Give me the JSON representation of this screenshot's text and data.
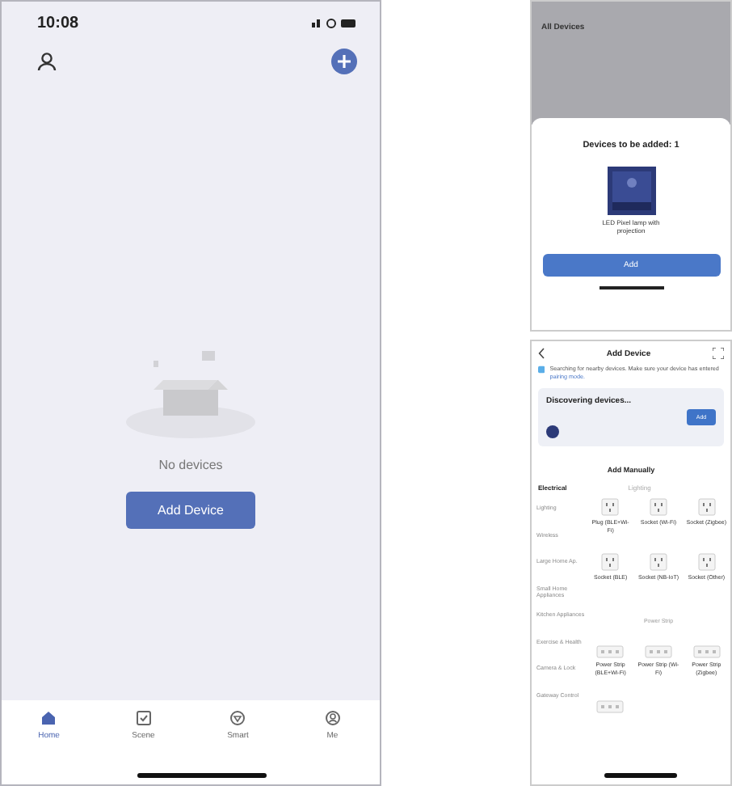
{
  "home": {
    "status_time": "10:08",
    "empty_text": "No devices",
    "add_button": "Add Device",
    "tabs": [
      {
        "label": "Home",
        "kind": "home",
        "selected": true
      },
      {
        "label": "Scene",
        "kind": "scene",
        "selected": false
      },
      {
        "label": "Smart",
        "kind": "smart",
        "selected": false
      },
      {
        "label": "Me",
        "kind": "me",
        "selected": false
      }
    ]
  },
  "found_sheet": {
    "backdrop_title": "All Devices",
    "title": "Devices to be added: 1",
    "device_name": "LED Pixel lamp with projection",
    "add_button": "Add"
  },
  "add_device": {
    "title": "Add Device",
    "tip": "Searching for nearby devices. Make sure your device has entered",
    "tip_link": "pairing mode.",
    "discover_text": "Discovering devices...",
    "discover_button": "Add",
    "manual_title": "Add Manually",
    "tabs": [
      {
        "label": "Electrical",
        "selected": true
      },
      {
        "label": "Lighting",
        "selected": false
      }
    ],
    "categories": [
      {
        "label": "Lighting"
      },
      {
        "label": "Wireless"
      },
      {
        "label": "Large Home Ap."
      },
      {
        "label": "Small Home Appliances"
      },
      {
        "label": "Kitchen Appliances"
      },
      {
        "label": "Exercise & Health"
      },
      {
        "label": "Camera & Lock"
      },
      {
        "label": "Gateway Control"
      }
    ],
    "sections": [
      {
        "items": [
          {
            "kind": "socket",
            "label": "Plug (BLE+Wi-Fi)"
          },
          {
            "kind": "socket",
            "label": "Socket (Wi-Fi)"
          },
          {
            "kind": "socket",
            "label": "Socket (Zigbee)"
          },
          {
            "kind": "socket",
            "label": "Socket (BLE)"
          },
          {
            "kind": "socket",
            "label": "Socket (NB-IoT)"
          },
          {
            "kind": "socket",
            "label": "Socket (Other)"
          }
        ]
      },
      {
        "title": "Power Strip",
        "items": [
          {
            "kind": "strip",
            "label": "Power Strip (BLE+Wi-Fi)"
          },
          {
            "kind": "strip",
            "label": "Power Strip (Wi-Fi)"
          },
          {
            "kind": "strip",
            "label": "Power Strip (Zigbee)"
          },
          {
            "kind": "strip"
          }
        ]
      }
    ]
  }
}
